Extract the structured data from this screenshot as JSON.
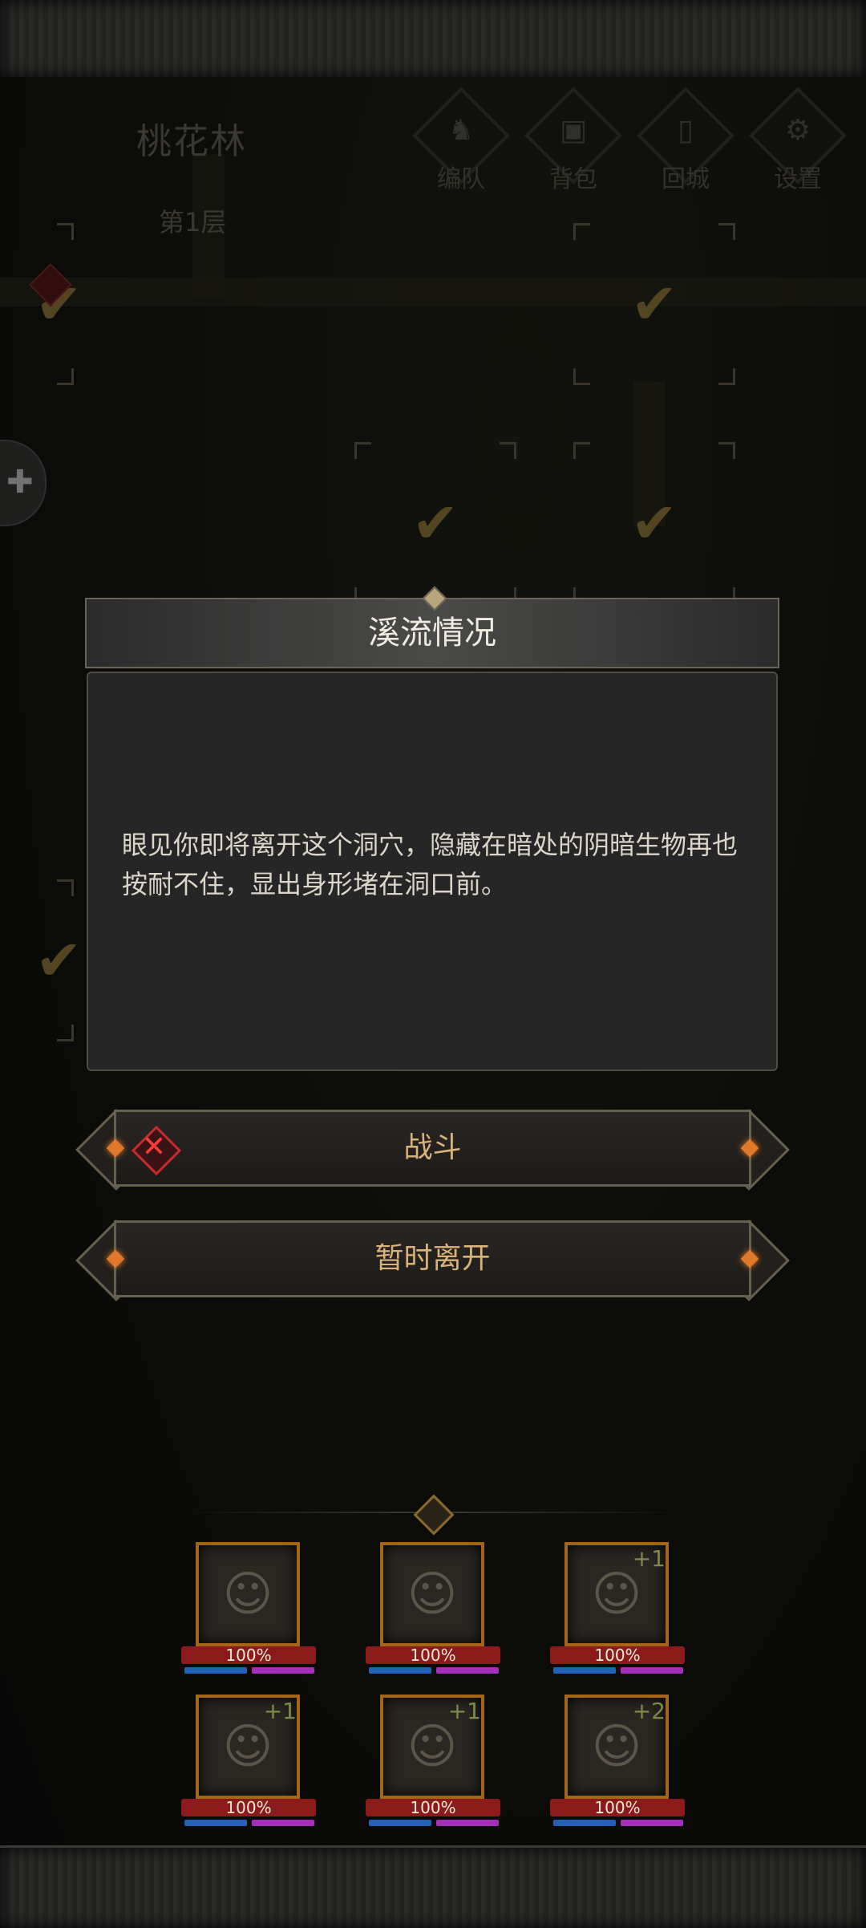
{
  "colors": {
    "accent_gold": "#d9b37a",
    "check_gold": "#9a7e3e",
    "hp_red": "#8b1b1b",
    "mp_blue": "#2460b8",
    "sp_purple": "#a42fb8",
    "danger_red": "#ff3b3b",
    "orb_orange": "#e07a2a"
  },
  "hud": {
    "location": "桃花林",
    "floor": "第1层",
    "buttons": [
      {
        "label": "编队",
        "icon": "formation-icon"
      },
      {
        "label": "背包",
        "icon": "backpack-icon"
      },
      {
        "label": "回城",
        "icon": "return-city-icon"
      },
      {
        "label": "设置",
        "icon": "settings-icon"
      }
    ]
  },
  "map": {
    "check_symbol": "✔"
  },
  "dialog": {
    "title": "溪流情况",
    "body": "眼见你即将离开这个洞穴，隐藏在暗处的阴暗生物再也按耐不住，显出身形堵在洞口前。"
  },
  "choices": [
    {
      "label": "战斗",
      "icon": "danger-icon",
      "has_warning": true
    },
    {
      "label": "暂时离开",
      "has_warning": false
    }
  ],
  "team": {
    "heroes": [
      {
        "hp": "100%",
        "bonus": "",
        "hp_fraction": 1.0
      },
      {
        "hp": "100%",
        "bonus": "",
        "hp_fraction": 1.0
      },
      {
        "hp": "100%",
        "bonus": "+1",
        "hp_fraction": 1.0
      },
      {
        "hp": "100%",
        "bonus": "+1",
        "hp_fraction": 1.0
      },
      {
        "hp": "100%",
        "bonus": "+1",
        "hp_fraction": 1.0
      },
      {
        "hp": "100%",
        "bonus": "+2",
        "hp_fraction": 1.0
      }
    ]
  }
}
